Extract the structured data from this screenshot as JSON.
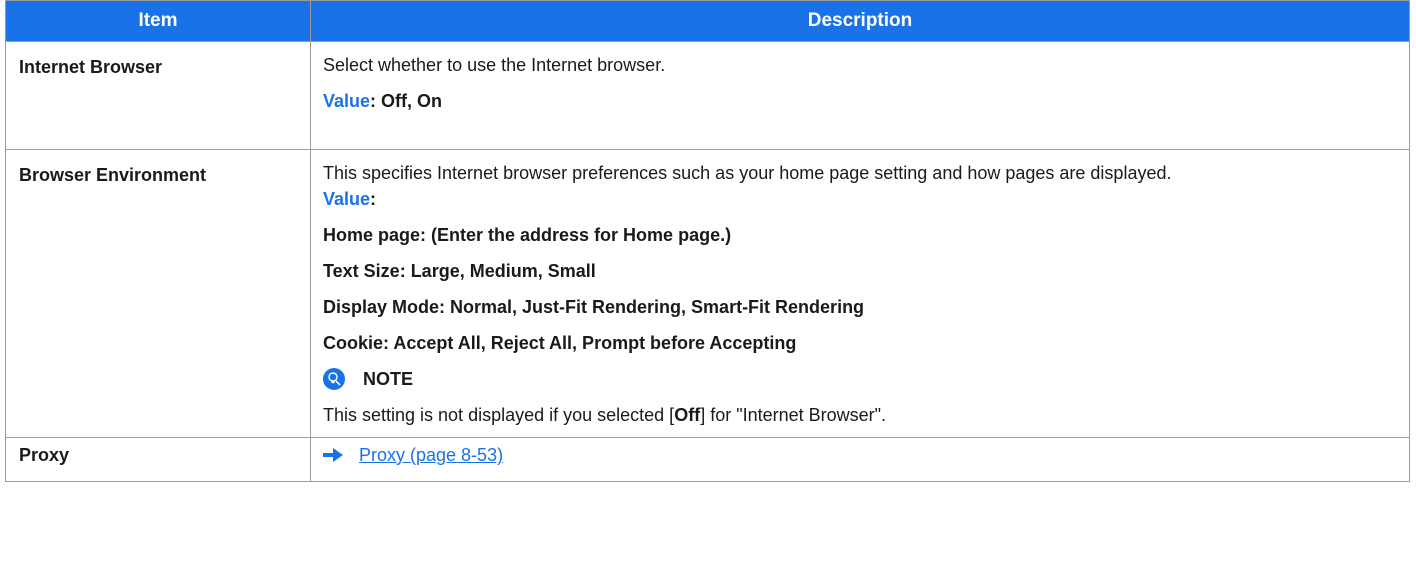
{
  "table": {
    "headers": {
      "item": "Item",
      "description": "Description"
    },
    "rows": [
      {
        "item": "Internet Browser",
        "description": "Select whether to use the Internet browser.",
        "value_label": "Value",
        "value_text": ": Off, On"
      },
      {
        "item": "Browser Environment",
        "description": "This specifies Internet browser preferences such as your home page setting and how pages are displayed.",
        "value_label": "Value",
        "value_text": ":",
        "options": [
          "Home page: (Enter the address for Home page.)",
          "Text Size: Large, Medium, Small",
          "Display Mode: Normal, Just-Fit Rendering, Smart-Fit Rendering",
          "Cookie: Accept All, Reject All, Prompt before Accepting"
        ],
        "note_title": "NOTE",
        "note_pre": "This setting is not displayed if you selected [",
        "note_bold": "Off",
        "note_post": "] for \"Internet Browser\"."
      },
      {
        "item": "Proxy",
        "link_text": "Proxy (page 8-53)"
      }
    ]
  },
  "colors": {
    "header_bg": "#1a72e8",
    "accent": "#1a72e8",
    "border": "#9a9a9a"
  },
  "icons": {
    "note": "note-bulb-icon",
    "arrow": "right-arrow-icon"
  }
}
